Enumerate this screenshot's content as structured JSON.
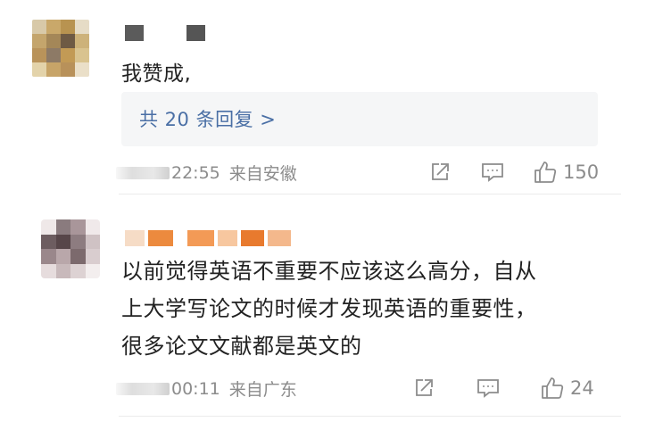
{
  "comments": [
    {
      "text": "我赞成,",
      "reply_link": "共 20 条回复 >",
      "time": "22:55",
      "location": "来自安徽",
      "like_count": "150",
      "icons": {
        "share": "share-icon",
        "comment": "comment-icon",
        "like": "thumbs-up-icon"
      }
    },
    {
      "text_lines": [
        "以前觉得英语不重要不应该这么高分，自从",
        "上大学写论文的时候才发现英语的重要性，",
        "很多论文文献都是英文的"
      ],
      "time": "00:11",
      "location": "来自广东",
      "like_count": "24",
      "icons": {
        "share": "share-icon",
        "comment": "comment-icon",
        "like": "thumbs-up-icon"
      }
    }
  ],
  "colors": {
    "link": "#4a6fa5",
    "meta_text": "#8c8c8c",
    "body_text": "#222222",
    "reply_bg": "#f5f6f7"
  }
}
